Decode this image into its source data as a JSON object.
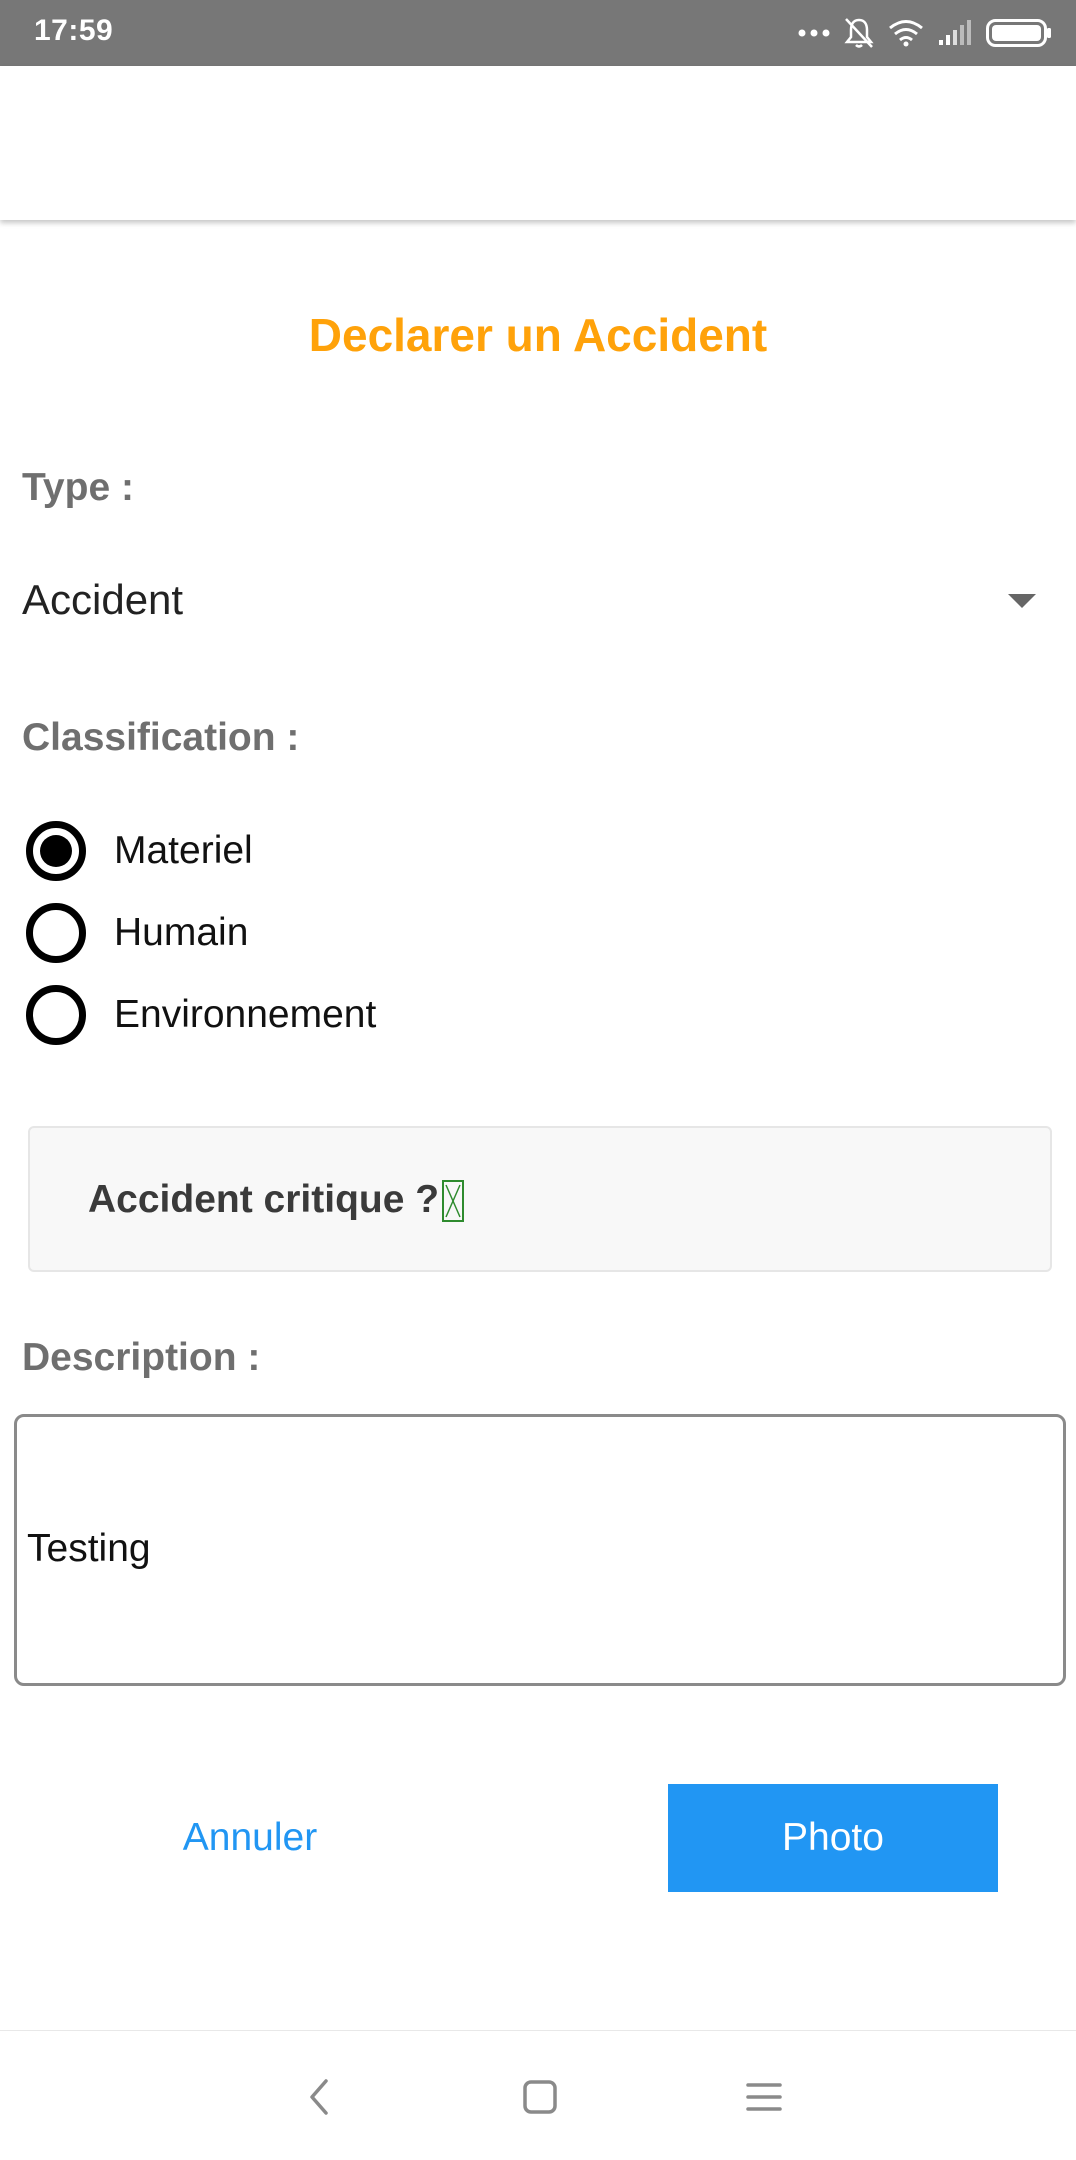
{
  "status_bar": {
    "time": "17:59",
    "icons": [
      "more-dots-icon",
      "bell-off-icon",
      "wifi-icon",
      "signal-icon",
      "battery-icon"
    ]
  },
  "page": {
    "title": "Declarer un Accident"
  },
  "type_field": {
    "label": "Type :",
    "selected": "Accident"
  },
  "classification": {
    "label": "Classification :",
    "options": [
      {
        "label": "Materiel",
        "checked": true
      },
      {
        "label": "Humain",
        "checked": false
      },
      {
        "label": "Environnement",
        "checked": false
      }
    ]
  },
  "critical": {
    "label": "Accident critique ?"
  },
  "description": {
    "label": "Description :",
    "value": "Testing"
  },
  "buttons": {
    "cancel": "Annuler",
    "photo": "Photo"
  },
  "colors": {
    "title": "#FFA20A",
    "primary": "#2196F3",
    "status_bar": "#777777"
  },
  "nav": {
    "icons": [
      "back-icon",
      "home-icon",
      "menu-icon"
    ]
  }
}
